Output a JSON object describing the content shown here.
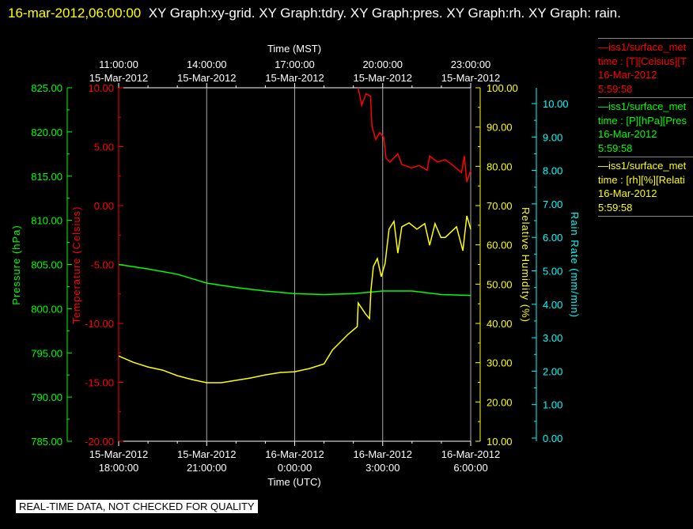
{
  "title": {
    "timestamp": "16-mar-2012,06:00:00",
    "text": "XY Graph:xy-grid.  XY Graph:tdry.  XY Graph:pres.  XY Graph:rh.  XY Graph: rain."
  },
  "footer": "REAL-TIME DATA, NOT CHECKED FOR QUALITY",
  "legend": [
    {
      "color": "#ff0000",
      "lines": [
        "—iss1/surface_met",
        "time : [T][Celsius][T",
        "16-Mar-2012",
        "5:59:58"
      ]
    },
    {
      "color": "#00ff00",
      "lines": [
        "—iss1/surface_met",
        "time : [P][hPa][Pres",
        "16-Mar-2012",
        "5:59:58"
      ]
    },
    {
      "color": "#ffff00",
      "lines": [
        "—iss1/surface_met",
        "time : [rh][%][Relati",
        "16-Mar-2012",
        "5:59:58"
      ]
    }
  ],
  "chart_data": {
    "type": "line",
    "grid": "vertical lines at major time ticks",
    "x_axis_bottom": {
      "label": "Time (UTC)",
      "range": [
        "2012-03-15T18:00",
        "2012-03-16T06:00"
      ],
      "ticks": [
        [
          "15-Mar-2012",
          "18:00:00"
        ],
        [
          "15-Mar-2012",
          "21:00:00"
        ],
        [
          "16-Mar-2012",
          "0:00:00"
        ],
        [
          "16-Mar-2012",
          "3:00:00"
        ],
        [
          "16-Mar-2012",
          "6:00:00"
        ]
      ]
    },
    "x_axis_top": {
      "label": "Time (MST)",
      "ticks": [
        [
          "11:00:00",
          "15-Mar-2012"
        ],
        [
          "14:00:00",
          "15-Mar-2012"
        ],
        [
          "17:00:00",
          "15-Mar-2012"
        ],
        [
          "20:00:00",
          "15-Mar-2012"
        ],
        [
          "23:00:00",
          "15-Mar-2012"
        ]
      ]
    },
    "y_axes": [
      {
        "id": "pressure",
        "label": "Pressure (hPa)",
        "color": "#00ff00",
        "range": [
          785,
          825
        ],
        "ticks": [
          "825.00",
          "820.00",
          "815.00",
          "810.00",
          "805.00",
          "800.00",
          "795.00",
          "790.00",
          "785.00"
        ]
      },
      {
        "id": "temperature",
        "label": "Temperature (Celsius)",
        "color": "#ff0000",
        "range": [
          -20,
          10
        ],
        "ticks": [
          "10.00",
          "5.00",
          "0.00",
          "-5.00",
          "-10.00",
          "-15.00",
          "-20.00"
        ]
      },
      {
        "id": "rh",
        "label": "Relative Humidity (%)",
        "color": "#ffff00",
        "range": [
          10,
          100
        ],
        "ticks": [
          "100.00",
          "90.00",
          "80.00",
          "70.00",
          "60.00",
          "50.00",
          "40.00",
          "30.00",
          "20.00",
          "10.00"
        ]
      },
      {
        "id": "rain",
        "label": "Rain Rate (mm/min)",
        "color": "#00ffff",
        "range": [
          0,
          10
        ],
        "ticks": [
          "10.00",
          "9.00",
          "8.00",
          "7.00",
          "6.00",
          "5.00",
          "4.00",
          "3.00",
          "2.00",
          "1.00",
          "0.00"
        ]
      }
    ],
    "series": [
      {
        "axis": "temperature",
        "color": "#ff0000",
        "points": [
          [
            "2012-03-16T02:10",
            10.0
          ],
          [
            "2012-03-16T02:17",
            8.5
          ],
          [
            "2012-03-16T02:26",
            9.5
          ],
          [
            "2012-03-16T02:35",
            9.3
          ],
          [
            "2012-03-16T02:38",
            6.7
          ],
          [
            "2012-03-16T02:46",
            5.6
          ],
          [
            "2012-03-16T02:54",
            6.2
          ],
          [
            "2012-03-16T03:02",
            5.8
          ],
          [
            "2012-03-16T03:07",
            4.0
          ],
          [
            "2012-03-16T03:15",
            3.7
          ],
          [
            "2012-03-16T03:31",
            4.4
          ],
          [
            "2012-03-16T03:39",
            3.5
          ],
          [
            "2012-03-16T03:59",
            3.2
          ],
          [
            "2012-03-16T04:15",
            3.4
          ],
          [
            "2012-03-16T04:31",
            3.0
          ],
          [
            "2012-03-16T04:36",
            4.2
          ],
          [
            "2012-03-16T04:52",
            3.7
          ],
          [
            "2012-03-16T05:08",
            3.9
          ],
          [
            "2012-03-16T05:24",
            3.4
          ],
          [
            "2012-03-16T05:41",
            2.8
          ],
          [
            "2012-03-16T05:47",
            4.2
          ],
          [
            "2012-03-16T05:52",
            2.0
          ],
          [
            "2012-03-16T06:00",
            3.0
          ]
        ]
      },
      {
        "axis": "pressure",
        "color": "#00ff00",
        "points": [
          [
            "2012-03-15T18:00",
            805.0
          ],
          [
            "2012-03-15T19:00",
            804.5
          ],
          [
            "2012-03-15T20:00",
            803.9
          ],
          [
            "2012-03-15T21:00",
            802.9
          ],
          [
            "2012-03-15T22:00",
            802.4
          ],
          [
            "2012-03-15T23:00",
            802.0
          ],
          [
            "2012-03-16T00:00",
            801.7
          ],
          [
            "2012-03-16T01:00",
            801.6
          ],
          [
            "2012-03-16T02:00",
            801.7
          ],
          [
            "2012-03-16T03:00",
            802.0
          ],
          [
            "2012-03-16T04:00",
            802.0
          ],
          [
            "2012-03-16T05:00",
            801.6
          ],
          [
            "2012-03-16T06:00",
            801.5
          ]
        ]
      },
      {
        "axis": "rh",
        "color": "#ffff00",
        "points": [
          [
            "2012-03-15T18:00",
            31.7
          ],
          [
            "2012-03-15T18:30",
            30.1
          ],
          [
            "2012-03-15T19:00",
            28.9
          ],
          [
            "2012-03-15T19:30",
            28.1
          ],
          [
            "2012-03-15T20:00",
            26.7
          ],
          [
            "2012-03-15T20:30",
            25.7
          ],
          [
            "2012-03-15T21:00",
            24.9
          ],
          [
            "2012-03-15T21:30",
            24.9
          ],
          [
            "2012-03-15T22:00",
            25.5
          ],
          [
            "2012-03-15T22:30",
            26.1
          ],
          [
            "2012-03-15T23:00",
            26.9
          ],
          [
            "2012-03-15T23:30",
            27.5
          ],
          [
            "2012-03-16T00:00",
            27.7
          ],
          [
            "2012-03-16T00:30",
            28.5
          ],
          [
            "2012-03-16T01:00",
            29.7
          ],
          [
            "2012-03-16T01:17",
            33.2
          ],
          [
            "2012-03-16T01:49",
            37.2
          ],
          [
            "2012-03-16T02:08",
            39.2
          ],
          [
            "2012-03-16T02:10",
            45.2
          ],
          [
            "2012-03-16T02:25",
            42.4
          ],
          [
            "2012-03-16T02:33",
            41.2
          ],
          [
            "2012-03-16T02:36",
            48.5
          ],
          [
            "2012-03-16T02:41",
            54.5
          ],
          [
            "2012-03-16T02:49",
            56.5
          ],
          [
            "2012-03-16T02:57",
            51.9
          ],
          [
            "2012-03-16T03:05",
            55.3
          ],
          [
            "2012-03-16T03:13",
            64.0
          ],
          [
            "2012-03-16T03:23",
            66.0
          ],
          [
            "2012-03-16T03:31",
            57.9
          ],
          [
            "2012-03-16T03:39",
            64.6
          ],
          [
            "2012-03-16T03:54",
            65.6
          ],
          [
            "2012-03-16T04:10",
            64.0
          ],
          [
            "2012-03-16T04:26",
            65.4
          ],
          [
            "2012-03-16T04:36",
            59.9
          ],
          [
            "2012-03-16T04:47",
            65.4
          ],
          [
            "2012-03-16T04:59",
            61.9
          ],
          [
            "2012-03-16T05:08",
            61.9
          ],
          [
            "2012-03-16T05:31",
            64.6
          ],
          [
            "2012-03-16T05:44",
            58.5
          ],
          [
            "2012-03-16T05:52",
            67.4
          ],
          [
            "2012-03-16T06:00",
            64.0
          ]
        ]
      }
    ]
  }
}
